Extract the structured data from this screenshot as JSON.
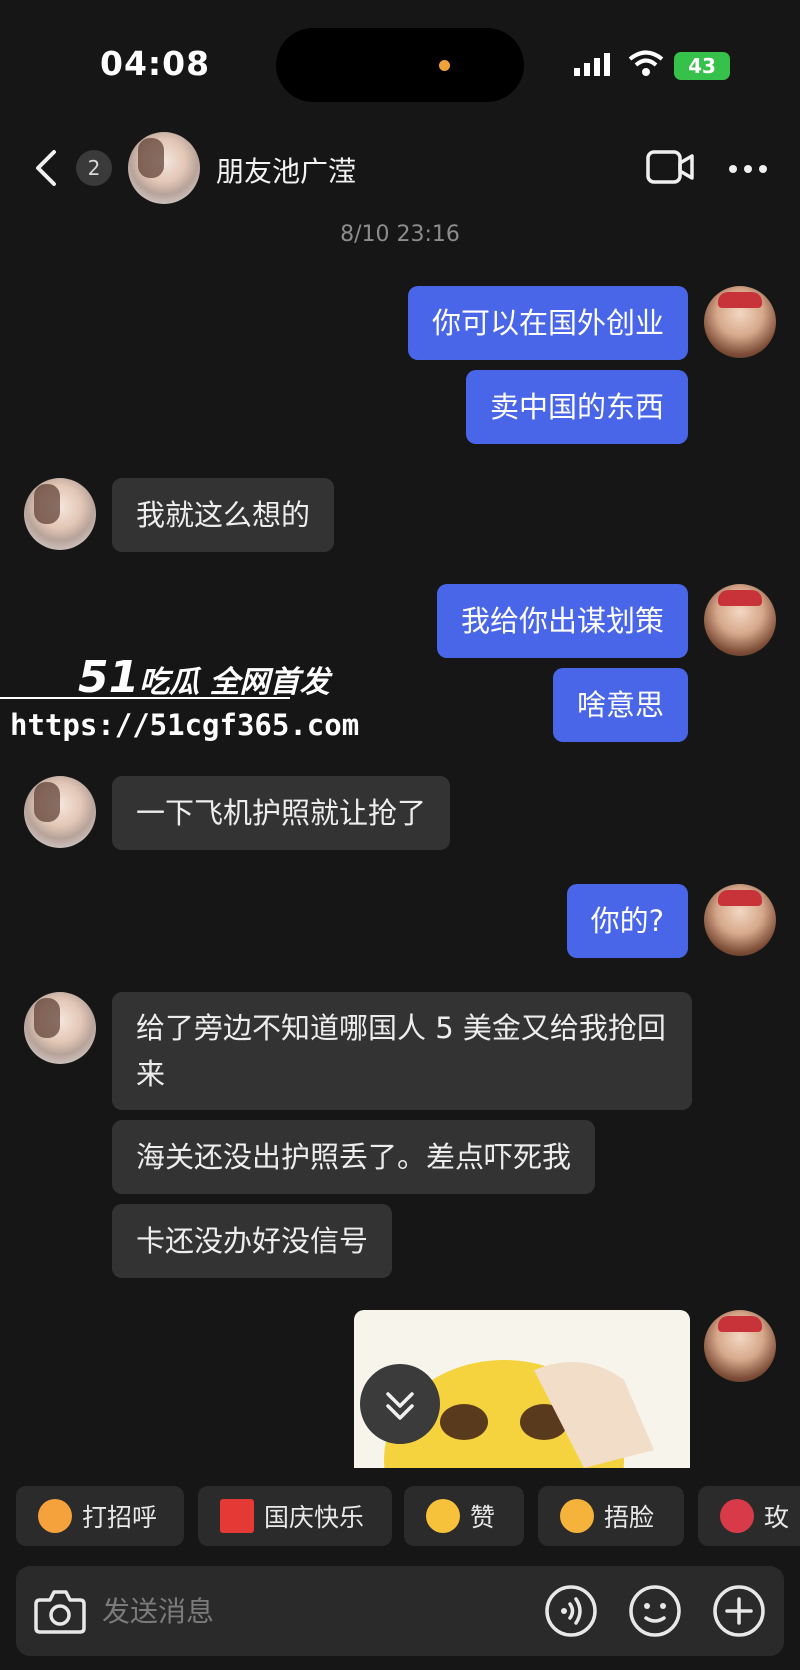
{
  "status_bar": {
    "time": "04:08",
    "battery": "43"
  },
  "header": {
    "unread_count": "2",
    "contact_name": "朋友池广滢"
  },
  "timestamp": "8/10 23:16",
  "messages": [
    {
      "from": "me",
      "text": "你可以在国外创业"
    },
    {
      "from": "me",
      "text": "卖中国的东西"
    },
    {
      "from": "other",
      "text": "我就这么想的"
    },
    {
      "from": "me",
      "text": "我给你出谋划策"
    },
    {
      "from": "me",
      "text": "啥意思"
    },
    {
      "from": "other",
      "text": "一下飞机护照就让抢了"
    },
    {
      "from": "me",
      "text": "你的?"
    },
    {
      "from": "other",
      "text": "给了旁边不知道哪国人 5 美金又给我抢回来"
    },
    {
      "from": "other",
      "text": "海关还没出护照丢了。差点吓死我"
    },
    {
      "from": "other",
      "text": "卡还没办好没信号"
    }
  ],
  "watermark": {
    "logo_num": "51",
    "logo_text": "吃瓜 全网首发",
    "url": "https://51cgf365.com"
  },
  "quick_replies": [
    {
      "label": "打招呼",
      "icon": "wave-emoji-icon",
      "color": "#f6a23c"
    },
    {
      "label": "国庆快乐",
      "icon": "red-flag-icon",
      "color": "#e53935"
    },
    {
      "label": "赞",
      "icon": "thumbs-up-icon",
      "color": "#f7c23b"
    },
    {
      "label": "捂脸",
      "icon": "facepalm-emoji-icon",
      "color": "#f6b33b"
    },
    {
      "label": "玫",
      "icon": "rose-icon",
      "color": "#d93a4a"
    }
  ],
  "input": {
    "placeholder": "发送消息"
  },
  "colors": {
    "my_bubble": "#4a66e8",
    "other_bubble": "#333333",
    "background": "#161616"
  }
}
